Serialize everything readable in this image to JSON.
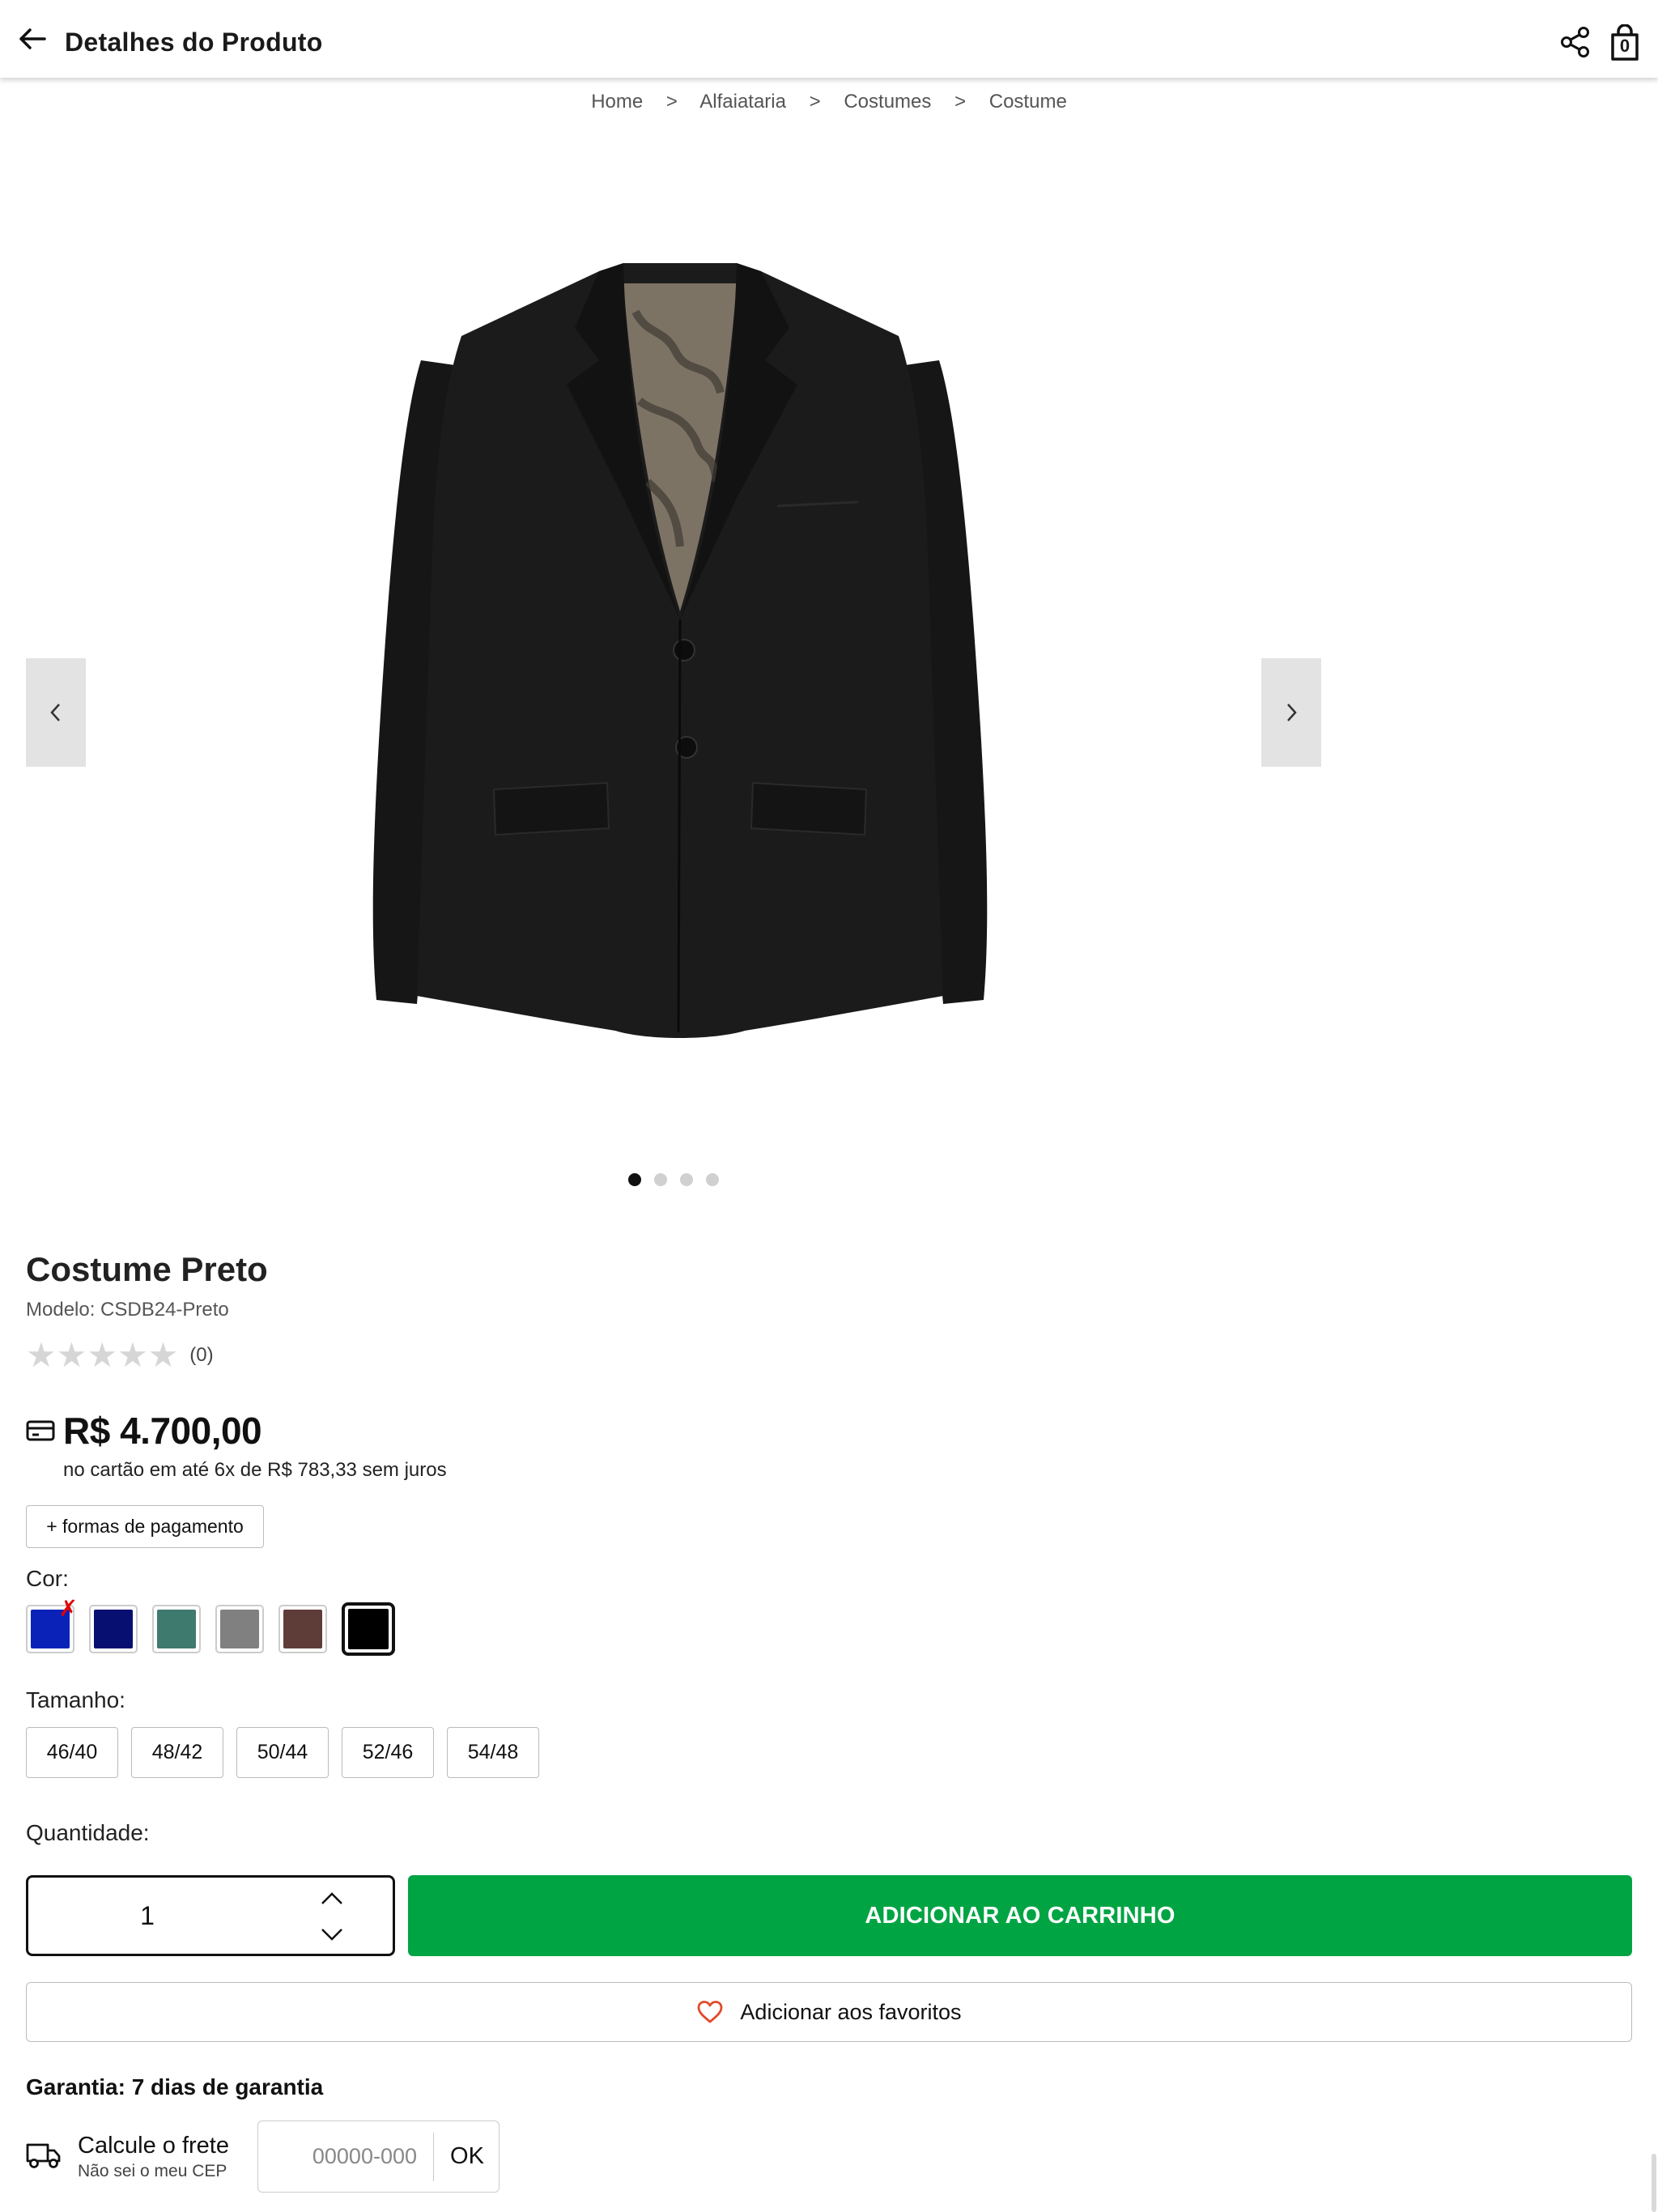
{
  "header": {
    "title": "Detalhes do Produto",
    "cart_count": "0"
  },
  "breadcrumb": [
    "Home",
    "Alfaiataria",
    "Costumes",
    "Costume"
  ],
  "breadcrumb_separator": ">",
  "gallery": {
    "slide_count": 4,
    "active_slide": 1
  },
  "product": {
    "name": "Costume Preto",
    "model": "Modelo: CSDB24-Preto",
    "rating_stars": 0,
    "rating_count": "(0)",
    "price": "R$ 4.700,00",
    "installments": "no cartão em até 6x de R$ 783,33 sem juros",
    "payment_button": "+ formas de pagamento"
  },
  "color": {
    "label": "Cor:",
    "options": [
      {
        "hex": "#0b22b8",
        "unavailable": true
      },
      {
        "hex": "#071070",
        "unavailable": false
      },
      {
        "hex": "#3f7a6f",
        "unavailable": false
      },
      {
        "hex": "#808080",
        "unavailable": false
      },
      {
        "hex": "#5e3d38",
        "unavailable": false
      },
      {
        "hex": "#000000",
        "unavailable": false,
        "selected": true
      }
    ],
    "unavailable_mark": "✗"
  },
  "size": {
    "label": "Tamanho:",
    "options": [
      "46/40",
      "48/42",
      "50/44",
      "52/46",
      "54/48"
    ]
  },
  "quantity": {
    "label": "Quantidade:",
    "value": "1"
  },
  "actions": {
    "add_to_cart": "ADICIONAR AO CARRINHO",
    "add_to_favorites": "Adicionar aos favoritos"
  },
  "warranty": "Garantia: 7 dias de garantia",
  "shipping": {
    "title": "Calcule o frete",
    "subtitle": "Não sei o meu CEP",
    "placeholder": "00000-000",
    "ok_label": "OK"
  },
  "colors": {
    "accent_green": "#00a443",
    "heart": "#e24a2b",
    "unavailable_mark": "#e10000"
  },
  "icons": {
    "back": "arrow-left-icon",
    "share": "share-icon",
    "bag": "shopping-bag-icon",
    "prev": "chevron-left-icon",
    "next": "chevron-right-icon",
    "card": "credit-card-icon",
    "heart": "heart-outline-icon",
    "truck": "truck-icon"
  }
}
